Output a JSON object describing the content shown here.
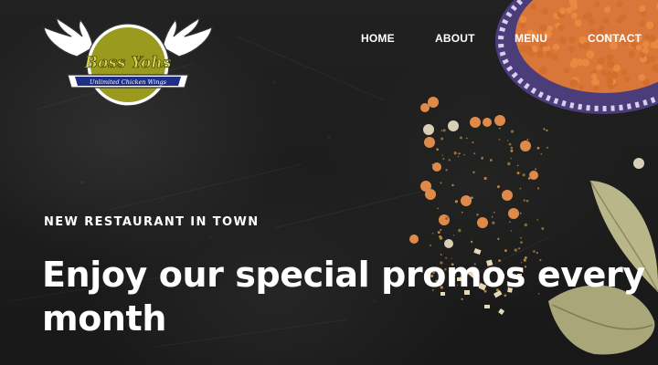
{
  "brand": {
    "logo_text": "Boss Yohs",
    "logo_tagline": "Unlimited Chicken Wings",
    "colors": {
      "olive": "#9a9a1e",
      "banner": "#1f2f86",
      "logo_text": "#d4d24a"
    }
  },
  "nav": {
    "items": [
      {
        "label": "HOME"
      },
      {
        "label": "ABOUT"
      },
      {
        "label": "MENU"
      },
      {
        "label": "CONTACT"
      }
    ]
  },
  "hero": {
    "eyebrow": "NEW RESTAURANT IN TOWN",
    "headline_line1": "Enjoy our special promos every",
    "headline_line2": "month"
  },
  "colors": {
    "background": "#1d1e1d",
    "text": "#ffffff",
    "lentil": "#e08a4a",
    "leaf": "#b9b68a"
  }
}
